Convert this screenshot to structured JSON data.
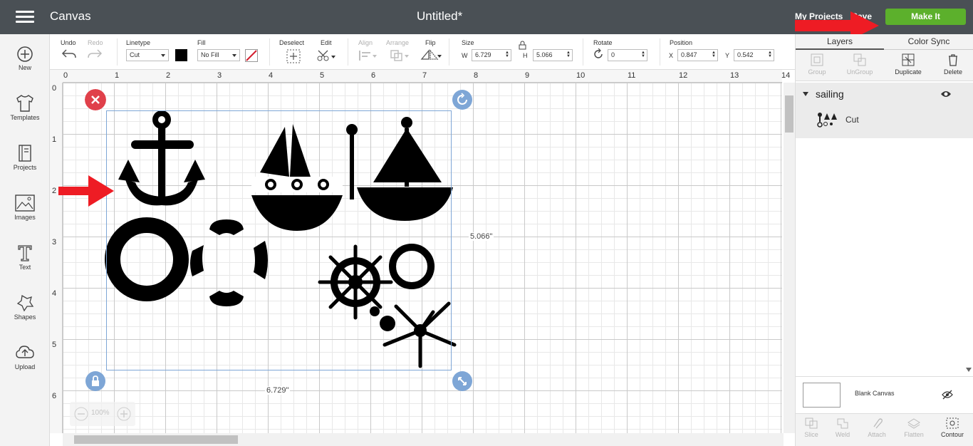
{
  "topbar": {
    "app_title": "Canvas",
    "document_title": "Untitled*",
    "my_projects": "My Projects",
    "save": "Save",
    "make_it": "Make It"
  },
  "leftbar": {
    "items": [
      {
        "label": "New",
        "icon": "plus-circle-icon"
      },
      {
        "label": "Templates",
        "icon": "shirt-icon"
      },
      {
        "label": "Projects",
        "icon": "book-icon"
      },
      {
        "label": "Images",
        "icon": "image-icon"
      },
      {
        "label": "Text",
        "icon": "text-icon"
      },
      {
        "label": "Shapes",
        "icon": "shapes-icon"
      },
      {
        "label": "Upload",
        "icon": "cloud-upload-icon"
      }
    ]
  },
  "toolbar": {
    "undo": "Undo",
    "redo": "Redo",
    "linetype_label": "Linetype",
    "linetype_value": "Cut",
    "fill_label": "Fill",
    "fill_value": "No Fill",
    "deselect": "Deselect",
    "edit": "Edit",
    "align": "Align",
    "arrange": "Arrange",
    "flip": "Flip",
    "size_label": "Size",
    "w_label": "W",
    "w_value": "6.729",
    "h_label": "H",
    "h_value": "5.066",
    "rotate_label": "Rotate",
    "rotate_value": "0",
    "position_label": "Position",
    "x_label": "X",
    "x_value": "0.847",
    "y_label": "Y",
    "y_value": "0.542",
    "accent_color": "#000000"
  },
  "canvas": {
    "ruler_top": [
      "0",
      "1",
      "2",
      "3",
      "4",
      "5",
      "6",
      "7",
      "8",
      "9",
      "10",
      "11",
      "12",
      "13",
      "14"
    ],
    "ruler_left": [
      "0",
      "1",
      "2",
      "3",
      "4",
      "5",
      "6"
    ],
    "width_label": "6.729\"",
    "height_label": "5.066\"",
    "zoom": "100%",
    "selection_color": "#7ea6d6",
    "delete_handle_color": "#e0404a",
    "handle_color": "#7ea6d6"
  },
  "rightpanel": {
    "tabs": [
      "Layers",
      "Color Sync"
    ],
    "tools": [
      {
        "label": "Group",
        "enabled": false
      },
      {
        "label": "UnGroup",
        "enabled": false
      },
      {
        "label": "Duplicate",
        "enabled": true
      },
      {
        "label": "Delete",
        "enabled": true
      }
    ],
    "layer_group_name": "sailing",
    "layer_item_type": "Cut",
    "blank_canvas": "Blank Canvas",
    "bottom_tools": [
      {
        "label": "Slice",
        "enabled": false
      },
      {
        "label": "Weld",
        "enabled": false
      },
      {
        "label": "Attach",
        "enabled": false
      },
      {
        "label": "Flatten",
        "enabled": false
      },
      {
        "label": "Contour",
        "enabled": true
      }
    ]
  },
  "annotation_color": "#ee1c24",
  "make_it_color": "#5cb02c"
}
